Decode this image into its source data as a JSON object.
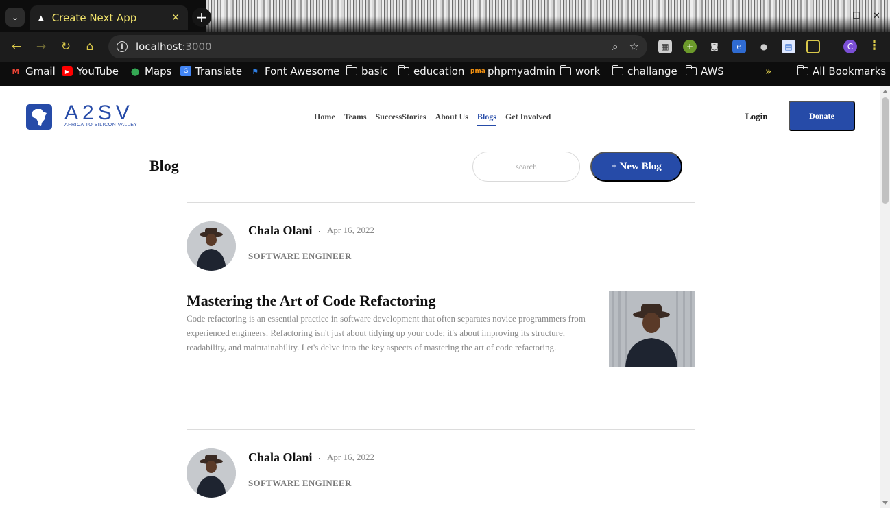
{
  "browser": {
    "tab_title": "Create Next App",
    "tab_close": "✕",
    "new_tab": "+",
    "url_host": "localhost",
    "url_port": ":3000",
    "profile_initial": "C",
    "bookmarks": [
      {
        "label": "Gmail",
        "icon": "gmail-icon"
      },
      {
        "label": "YouTube",
        "icon": "youtube-icon"
      },
      {
        "label": "Maps",
        "icon": "maps-icon"
      },
      {
        "label": "Translate",
        "icon": "translate-icon"
      },
      {
        "label": "Font Awesome",
        "icon": "font-awesome-icon"
      },
      {
        "label": "basic",
        "icon": "folder-icon"
      },
      {
        "label": "education",
        "icon": "folder-icon"
      },
      {
        "label": "phpmyadmin",
        "icon": "phpmyadmin-icon"
      },
      {
        "label": "work",
        "icon": "folder-icon"
      },
      {
        "label": "challange",
        "icon": "folder-icon"
      },
      {
        "label": "AWS",
        "icon": "folder-icon"
      }
    ],
    "bookmarks_overflow": "»",
    "all_bookmarks": "All Bookmarks"
  },
  "header": {
    "logo_word": "A2SV",
    "logo_tagline": "AFRICA TO SILICON VALLEY",
    "nav": [
      {
        "label": "Home",
        "active": false
      },
      {
        "label": "Teams",
        "active": false
      },
      {
        "label": "SuccessStories",
        "active": false
      },
      {
        "label": "About Us",
        "active": false
      },
      {
        "label": "Blogs",
        "active": true
      },
      {
        "label": "Get Involved",
        "active": false
      }
    ],
    "login_label": "Login",
    "donate_label": "Donate"
  },
  "blog": {
    "heading": "Blog",
    "search_placeholder": "search",
    "new_blog_label": "+ New Blog"
  },
  "posts": [
    {
      "author": "Chala Olani",
      "date": "Apr 16, 2022",
      "role": "SOFTWARE ENGINEER",
      "title": "Mastering the Art of Code Refactoring",
      "excerpt": "Code refactoring is an essential practice in software development that often separates novice programmers from experienced engineers. Refactoring isn't just about tidying up your code; it's about improving its structure, readability, and maintainability. Let's delve into the key aspects of mastering the art of code refactoring."
    },
    {
      "author": "Chala Olani",
      "date": "Apr 16, 2022",
      "role": "SOFTWARE ENGINEER"
    }
  ],
  "colors": {
    "brand": "#264ba8",
    "chrome_bg": "#1c1c1c",
    "tab_text": "#f1e36b"
  }
}
